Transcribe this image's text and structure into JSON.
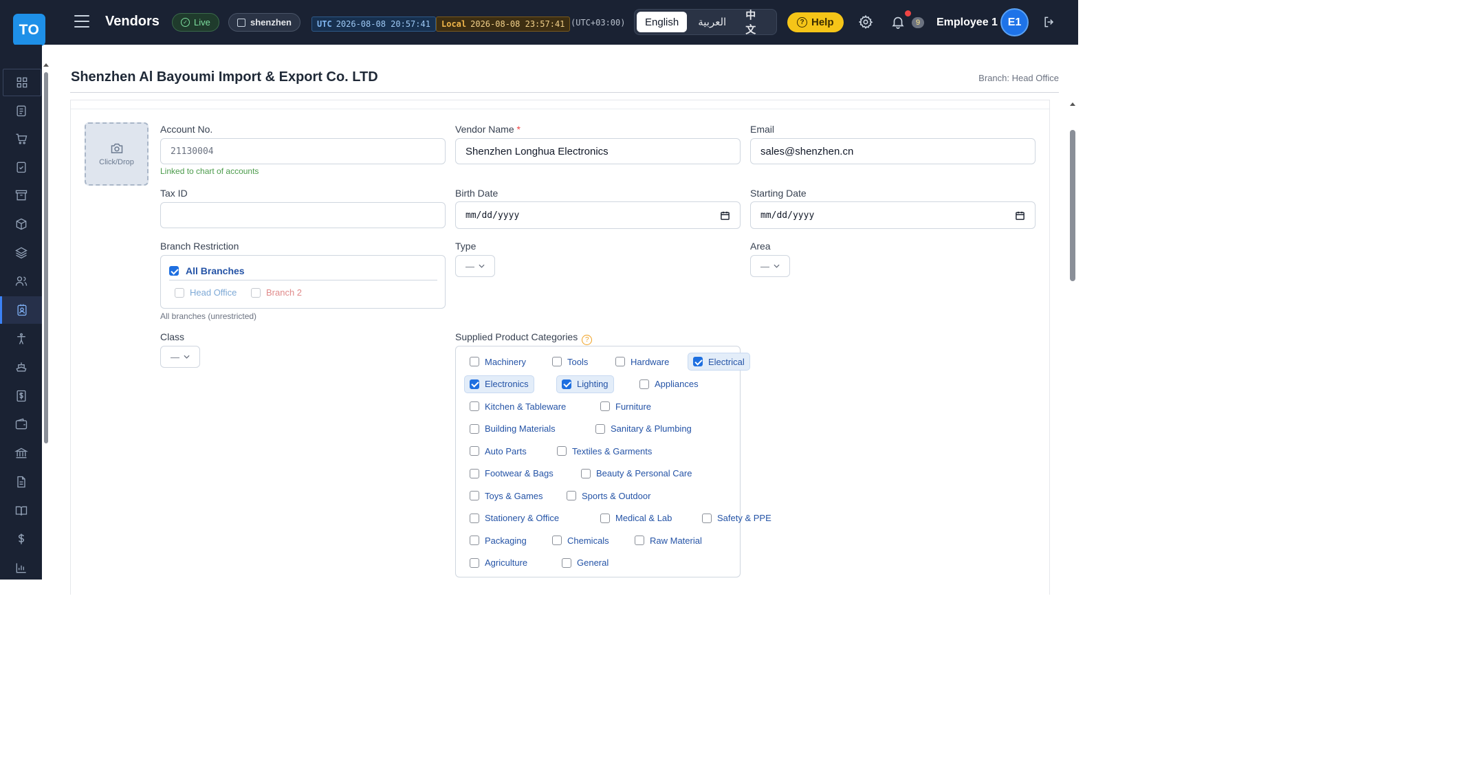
{
  "header": {
    "logo_text": "TO",
    "app_title": "Vendors",
    "status": "Live",
    "org": "shenzhen",
    "utc_label": "UTC",
    "utc_time": "2026-08-08 20:57:41",
    "local_label": "Local",
    "local_time": "2026-08-08 23:57:41",
    "timezone": "(UTC+03:00)",
    "languages": [
      "English",
      "العربية",
      "中文"
    ],
    "active_language": "English",
    "help_label": "Help",
    "notification_count": "9",
    "user_name": "Employee 1",
    "user_initials": "E1"
  },
  "sidebar": {
    "items": [
      "dashboard",
      "orders",
      "cart",
      "tasks",
      "archive",
      "products",
      "layers",
      "users",
      "vendors",
      "accessibility",
      "shipping",
      "finance",
      "wallet",
      "bank",
      "documents",
      "ledger",
      "currency",
      "reports"
    ],
    "active": "vendors"
  },
  "page": {
    "title": "Shenzhen Al Bayoumi Import & Export Co. LTD",
    "branch": "Branch: Head Office"
  },
  "form": {
    "photo_label": "Click/Drop",
    "account_no": {
      "label": "Account No.",
      "value": "21130004",
      "hint": "Linked to chart of accounts"
    },
    "vendor_name": {
      "label": "Vendor Name",
      "required": "*",
      "value": "Shenzhen Longhua Electronics"
    },
    "email": {
      "label": "Email",
      "value": "sales@shenzhen.cn"
    },
    "tax_id": {
      "label": "Tax ID",
      "value": ""
    },
    "birth_date": {
      "label": "Birth Date",
      "placeholder": "mm/dd/yyyy"
    },
    "starting_date": {
      "label": "Starting Date",
      "placeholder": "mm/dd/yyyy"
    },
    "branch_restriction": {
      "label": "Branch Restriction",
      "all_label": "All Branches",
      "all_checked": true,
      "options": [
        {
          "label": "Head Office",
          "checked": false,
          "color": "#7ea9d6"
        },
        {
          "label": "Branch 2",
          "checked": false,
          "color": "#e08a8a"
        }
      ],
      "hint": "All branches (unrestricted)"
    },
    "type": {
      "label": "Type",
      "value": "—"
    },
    "area": {
      "label": "Area",
      "value": "—"
    },
    "class": {
      "label": "Class",
      "value": "—"
    },
    "categories": {
      "label": "Supplied Product Categories",
      "items": [
        {
          "label": "Machinery",
          "checked": false
        },
        {
          "label": "Tools",
          "checked": false
        },
        {
          "label": "Hardware",
          "checked": false
        },
        {
          "label": "Electrical",
          "checked": true
        },
        {
          "label": "Electronics",
          "checked": true
        },
        {
          "label": "Lighting",
          "checked": true
        },
        {
          "label": "Appliances",
          "checked": false
        },
        {
          "label": "Kitchen & Tableware",
          "checked": false
        },
        {
          "label": "Furniture",
          "checked": false
        },
        {
          "label": "Building Materials",
          "checked": false
        },
        {
          "label": "Sanitary & Plumbing",
          "checked": false
        },
        {
          "label": "Auto Parts",
          "checked": false
        },
        {
          "label": "Textiles & Garments",
          "checked": false
        },
        {
          "label": "Footwear & Bags",
          "checked": false
        },
        {
          "label": "Beauty & Personal Care",
          "checked": false
        },
        {
          "label": "Toys & Games",
          "checked": false
        },
        {
          "label": "Sports & Outdoor",
          "checked": false
        },
        {
          "label": "Stationery & Office",
          "checked": false
        },
        {
          "label": "Medical & Lab",
          "checked": false
        },
        {
          "label": "Safety & PPE",
          "checked": false
        },
        {
          "label": "Packaging",
          "checked": false
        },
        {
          "label": "Chemicals",
          "checked": false
        },
        {
          "label": "Raw Material",
          "checked": false
        },
        {
          "label": "Agriculture",
          "checked": false
        },
        {
          "label": "General",
          "checked": false
        }
      ]
    }
  }
}
